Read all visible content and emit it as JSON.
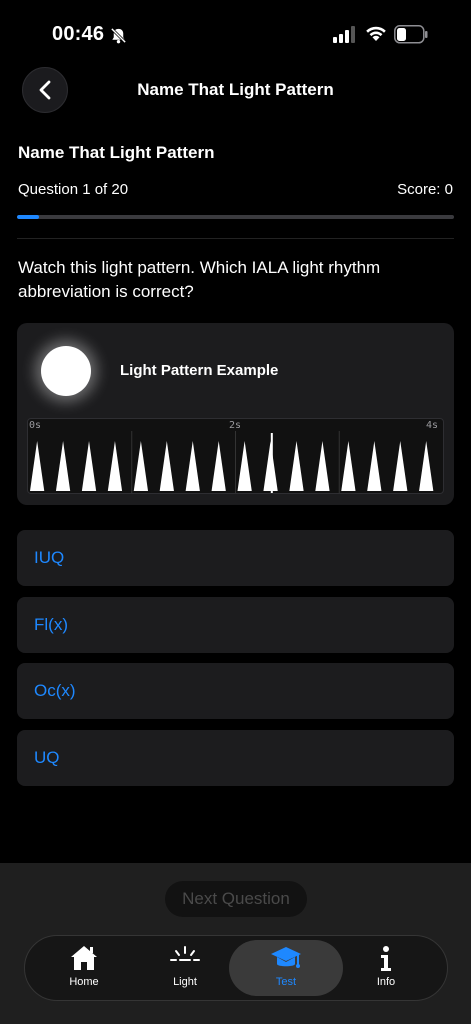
{
  "status_bar": {
    "time": "00:46"
  },
  "nav": {
    "title": "Name That Light Pattern"
  },
  "quiz": {
    "title": "Name That Light Pattern",
    "progress_text": "Question 1 of 20",
    "score_text": "Score: 0",
    "progress_fraction": 0.05,
    "question": "Watch this light pattern. Which IALA light rhythm abbreviation is correct?"
  },
  "pattern": {
    "title": "Light Pattern Example",
    "tick_labels": [
      "0s",
      "2s",
      "4s"
    ],
    "flashes_per_second": 4,
    "duration_seconds": 4
  },
  "answers": [
    "IUQ",
    "Fl(x)",
    "Oc(x)",
    "UQ"
  ],
  "next_button": "Next Question",
  "tabs": [
    {
      "label": "Home",
      "icon": "house-icon"
    },
    {
      "label": "Light",
      "icon": "light-rays-icon"
    },
    {
      "label": "Test",
      "icon": "graduation-cap-icon",
      "active": true
    },
    {
      "label": "Info",
      "icon": "info-icon"
    }
  ],
  "colors": {
    "accent": "#1e88ff",
    "background": "#000000",
    "card": "#1c1c1e"
  }
}
